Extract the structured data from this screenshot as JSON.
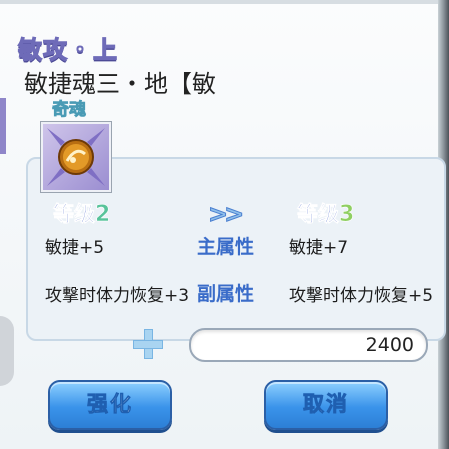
{
  "dialog": {
    "title": "敏攻・上",
    "subtitle": "敏捷魂三・地【敏"
  },
  "item": {
    "type_label": "奇魂",
    "icon": "soul-gem-icon"
  },
  "upgrade": {
    "level_label": "等级",
    "current_level": "2",
    "next_level": "3",
    "arrow": ">>",
    "main_attr_label": "主属性",
    "sub_attr_label": "副属性",
    "current_main": "敏捷+5",
    "next_main": "敏捷+7",
    "current_sub": "攻撃时体力恢复+3",
    "next_sub": "攻撃时体力恢复+5"
  },
  "cost": {
    "value": "2400"
  },
  "buttons": {
    "enhance": "强化",
    "cancel": "取消"
  },
  "colors": {
    "accent_blue": "#3a93ea",
    "title_purple": "#6e6bb8",
    "level_green": "#8fcf62"
  }
}
